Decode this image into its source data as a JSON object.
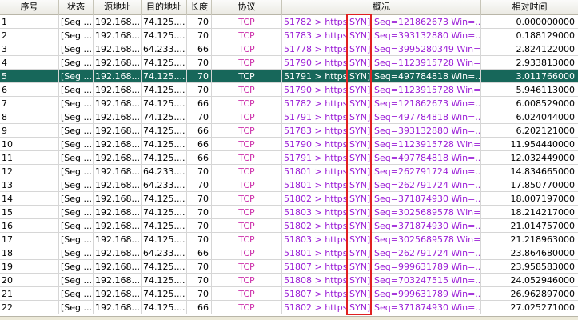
{
  "headers": {
    "no": "序号",
    "state": "状态",
    "src": "源地址",
    "dst": "目的地址",
    "len": "长度",
    "proto": "协议",
    "summary": "概况",
    "time": "相对时间"
  },
  "rows": [
    {
      "no": "1",
      "state": "[Seg ...",
      "src": "192.168...",
      "dst": "74.125....",
      "len": "70",
      "proto": "TCP",
      "port": "51782 > https",
      "flag": "SYN]",
      "info": "Seq=121862673 Win=...",
      "time": "0.000000000"
    },
    {
      "no": "2",
      "state": "[Seg ...",
      "src": "192.168...",
      "dst": "74.125....",
      "len": "70",
      "proto": "TCP",
      "port": "51783 > https",
      "flag": "SYN]",
      "info": "Seq=393132880 Win=...",
      "time": "0.188129000"
    },
    {
      "no": "3",
      "state": "[Seg ...",
      "src": "192.168...",
      "dst": "64.233....",
      "len": "66",
      "proto": "TCP",
      "port": "51778 > https",
      "flag": "SYN]",
      "info": "Seq=3995280349 Win=...",
      "time": "2.824122000"
    },
    {
      "no": "4",
      "state": "[Seg ...",
      "src": "192.168...",
      "dst": "74.125....",
      "len": "70",
      "proto": "TCP",
      "port": "51790 > https",
      "flag": "SYN]",
      "info": "Seq=1123915728 Win=...",
      "time": "2.933813000"
    },
    {
      "no": "5",
      "state": "[Seg ...",
      "src": "192.168...",
      "dst": "74.125....",
      "len": "70",
      "proto": "TCP",
      "port": "51791 > https",
      "flag": "SYN]",
      "info": "Seq=497784818 Win=...",
      "time": "3.011766000",
      "selected": true
    },
    {
      "no": "6",
      "state": "[Seg ...",
      "src": "192.168...",
      "dst": "74.125....",
      "len": "70",
      "proto": "TCP",
      "port": "51790 > https",
      "flag": "SYN]",
      "info": "Seq=1123915728 Win=...",
      "time": "5.946113000"
    },
    {
      "no": "7",
      "state": "[Seg ...",
      "src": "192.168...",
      "dst": "74.125....",
      "len": "66",
      "proto": "TCP",
      "port": "51782 > https",
      "flag": "SYN]",
      "info": "Seq=121862673 Win=...",
      "time": "6.008529000"
    },
    {
      "no": "8",
      "state": "[Seg ...",
      "src": "192.168...",
      "dst": "74.125....",
      "len": "70",
      "proto": "TCP",
      "port": "51791 > https",
      "flag": "SYN]",
      "info": "Seq=497784818 Win=...",
      "time": "6.024044000"
    },
    {
      "no": "9",
      "state": "[Seg ...",
      "src": "192.168...",
      "dst": "74.125....",
      "len": "66",
      "proto": "TCP",
      "port": "51783 > https",
      "flag": "SYN]",
      "info": "Seq=393132880 Win=...",
      "time": "6.202121000"
    },
    {
      "no": "10",
      "state": "[Seg ...",
      "src": "192.168...",
      "dst": "74.125....",
      "len": "66",
      "proto": "TCP",
      "port": "51790 > https",
      "flag": "SYN]",
      "info": "Seq=1123915728 Win=...",
      "time": "11.954440000"
    },
    {
      "no": "11",
      "state": "[Seg ...",
      "src": "192.168...",
      "dst": "74.125....",
      "len": "66",
      "proto": "TCP",
      "port": "51791 > https",
      "flag": "SYN]",
      "info": "Seq=497784818 Win=...",
      "time": "12.032449000"
    },
    {
      "no": "12",
      "state": "[Seg ...",
      "src": "192.168...",
      "dst": "64.233....",
      "len": "70",
      "proto": "TCP",
      "port": "51801 > https",
      "flag": "SYN]",
      "info": "Seq=262791724 Win=...",
      "time": "14.834665000"
    },
    {
      "no": "13",
      "state": "[Seg ...",
      "src": "192.168...",
      "dst": "64.233....",
      "len": "70",
      "proto": "TCP",
      "port": "51801 > https",
      "flag": "SYN]",
      "info": "Seq=262791724 Win=...",
      "time": "17.850770000"
    },
    {
      "no": "14",
      "state": "[Seg ...",
      "src": "192.168...",
      "dst": "74.125....",
      "len": "70",
      "proto": "TCP",
      "port": "51802 > https",
      "flag": "SYN]",
      "info": "Seq=371874930 Win=...",
      "time": "18.007197000"
    },
    {
      "no": "15",
      "state": "[Seg ...",
      "src": "192.168...",
      "dst": "74.125....",
      "len": "70",
      "proto": "TCP",
      "port": "51803 > https",
      "flag": "SYN]",
      "info": "Seq=3025689578 Win=...",
      "time": "18.214217000"
    },
    {
      "no": "16",
      "state": "[Seg ...",
      "src": "192.168...",
      "dst": "74.125....",
      "len": "70",
      "proto": "TCP",
      "port": "51802 > https",
      "flag": "SYN]",
      "info": "Seq=371874930 Win=...",
      "time": "21.014757000"
    },
    {
      "no": "17",
      "state": "[Seg ...",
      "src": "192.168...",
      "dst": "74.125....",
      "len": "70",
      "proto": "TCP",
      "port": "51803 > https",
      "flag": "SYN]",
      "info": "Seq=3025689578 Win=...",
      "time": "21.218963000"
    },
    {
      "no": "18",
      "state": "[Seg ...",
      "src": "192.168...",
      "dst": "64.233....",
      "len": "66",
      "proto": "TCP",
      "port": "51801 > https",
      "flag": "SYN]",
      "info": "Seq=262791724 Win=...",
      "time": "23.864680000"
    },
    {
      "no": "19",
      "state": "[Seg ...",
      "src": "192.168...",
      "dst": "74.125....",
      "len": "70",
      "proto": "TCP",
      "port": "51807 > https",
      "flag": "SYN]",
      "info": "Seq=999631789 Win=...",
      "time": "23.958583000"
    },
    {
      "no": "20",
      "state": "[Seg ...",
      "src": "192.168...",
      "dst": "74.125....",
      "len": "70",
      "proto": "TCP",
      "port": "51808 > https",
      "flag": "SYN]",
      "info": "Seq=703247515 Win=...",
      "time": "24.052946000"
    },
    {
      "no": "21",
      "state": "[Seg ...",
      "src": "192.168...",
      "dst": "74.125....",
      "len": "70",
      "proto": "TCP",
      "port": "51807 > https",
      "flag": "SYN]",
      "info": "Seq=999631789 Win=...",
      "time": "26.962897000"
    },
    {
      "no": "22",
      "state": "[Seg ...",
      "src": "192.168...",
      "dst": "74.125....",
      "len": "66",
      "proto": "TCP",
      "port": "51802 > https",
      "flag": "SYN]",
      "info": "Seq=371874930 Win=...",
      "time": "27.025271000"
    }
  ]
}
